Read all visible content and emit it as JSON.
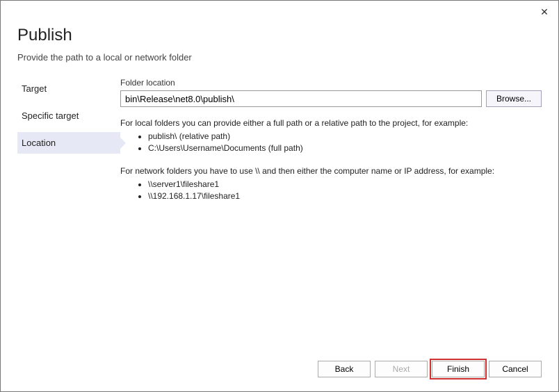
{
  "close_label": "✕",
  "header": {
    "title": "Publish",
    "subtitle": "Provide the path to a local or network folder"
  },
  "sidebar": {
    "items": [
      {
        "label": "Target",
        "active": false
      },
      {
        "label": "Specific target",
        "active": false
      },
      {
        "label": "Location",
        "active": true
      }
    ]
  },
  "main": {
    "folder_label": "Folder location",
    "folder_value": "bin\\Release\\net8.0\\publish\\",
    "browse_label": "Browse...",
    "help": {
      "local_intro": "For local folders you can provide either a full path or a relative path to the project, for example:",
      "local_examples": [
        "publish\\ (relative path)",
        "C:\\Users\\Username\\Documents (full path)"
      ],
      "network_intro": "For network folders you have to use \\\\ and then either the computer name or IP address, for example:",
      "network_examples": [
        "\\\\server1\\fileshare1",
        "\\\\192.168.1.17\\fileshare1"
      ]
    }
  },
  "footer": {
    "back": "Back",
    "next": "Next",
    "finish": "Finish",
    "cancel": "Cancel"
  }
}
